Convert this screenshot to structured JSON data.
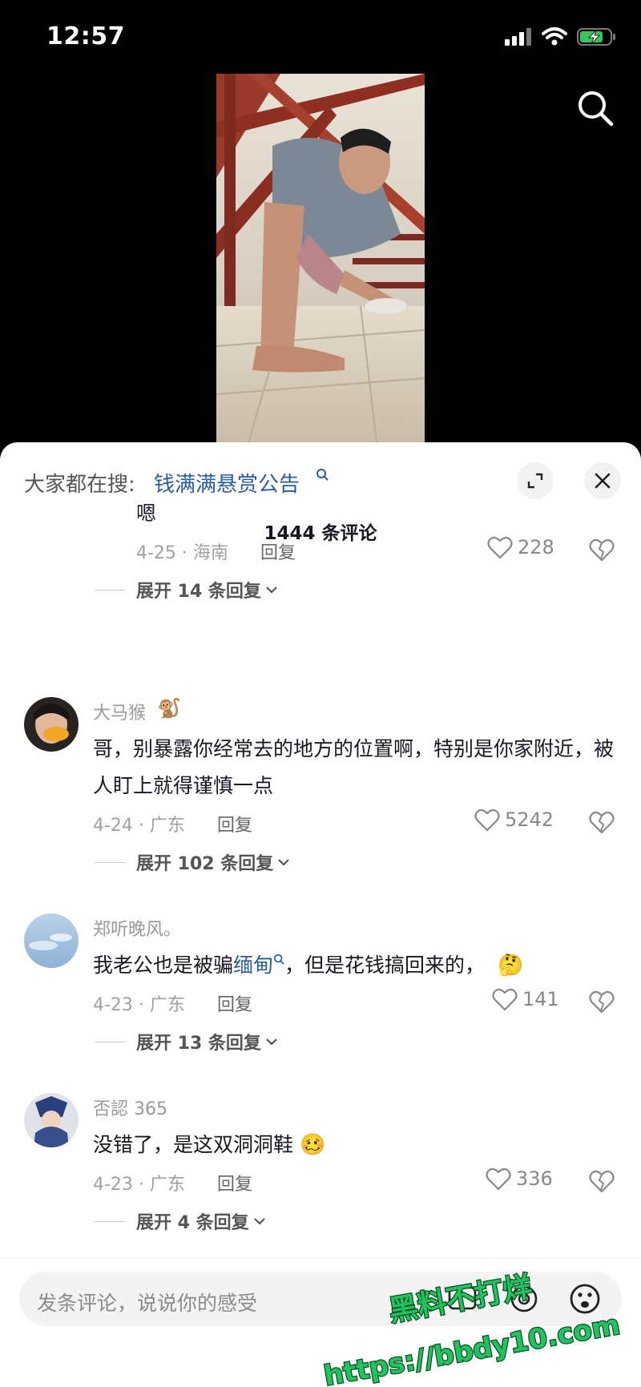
{
  "status_bar": {
    "time": "12:57"
  },
  "sheet": {
    "trend_prefix": "大家都在搜:",
    "trend_query": "钱满满悬赏公告",
    "comment_count": "1444 条评论"
  },
  "comments": [
    {
      "text": "嗯",
      "date_location": "4-25 · 海南",
      "reply_label": "回复",
      "likes": "228",
      "expand_label": "展开 14 条回复"
    },
    {
      "username": "大马猴",
      "text": "哥，别暴露你经常去的地方的位置啊，特别是你家附近，被人盯上就得谨慎一点",
      "date_location": "4-24 · 广东",
      "reply_label": "回复",
      "likes": "5242",
      "expand_label": "展开 102 条回复"
    },
    {
      "username": "郑听晚风。",
      "text_before": "我老公也是被骗",
      "link_text": "缅甸",
      "text_after": "，但是花钱搞回来的，",
      "date_location": "4-23 · 广东",
      "reply_label": "回复",
      "likes": "141",
      "expand_label": "展开 13 条回复"
    },
    {
      "username": "否認 365",
      "text": "没错了，是这双洞洞鞋",
      "date_location": "4-23 · 广东",
      "reply_label": "回复",
      "likes": "336",
      "expand_label": "展开 4 条回复"
    }
  ],
  "input": {
    "placeholder": "发条评论，说说你的感受"
  },
  "watermark": {
    "line1": "黑料不打烊",
    "line2": "https://bbdy10.com"
  },
  "colors": {
    "link": "#2a5d9b",
    "watermark_fill": "#22c35e"
  }
}
